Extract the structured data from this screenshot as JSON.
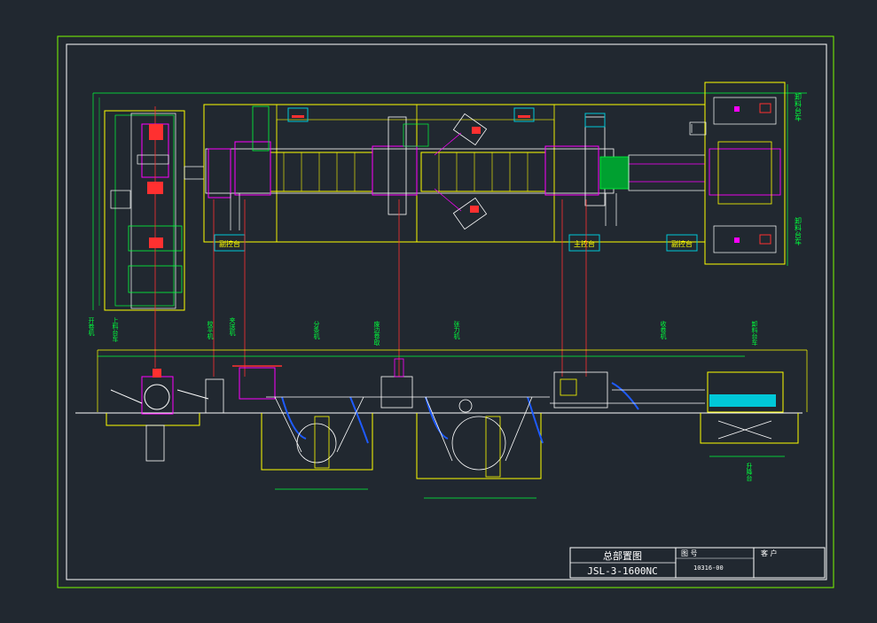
{
  "title_block": {
    "drawing_title": "总部置图",
    "model_number": "JSL-3-1600NC",
    "drawing_no_label": "图 号",
    "drawing_no_value": "10316-00",
    "client_label": "客 户",
    "client_value": ""
  },
  "plan_labels": {
    "sub_console_left": "副控台",
    "main_console": "主控台",
    "sub_console_right": "副控台",
    "unload_cart_top": "卸料台车",
    "unload_cart_bottom": "卸料台车"
  },
  "elevation_labels": {
    "uncoiler_support": "开卷机",
    "feed_cart": "上料台车",
    "leveler": "校平机",
    "pinch": "夹送机",
    "slitter": "分条机",
    "scrap_winder": "废边卷取",
    "tension": "张力机",
    "recoiler": "收卷机",
    "lift_table": "升降台",
    "discharge_cart": "卸料台车"
  },
  "colors": {
    "background": "#212830",
    "frame": "#7CFC00",
    "white_line": "#FFFFFF",
    "yellow_line": "#FFFF00",
    "green_line": "#00FF3C",
    "red_line": "#FF3030",
    "magenta_line": "#FF00FF",
    "blue_line": "#1E5BFF",
    "cyan_fill": "#00C8D8"
  }
}
